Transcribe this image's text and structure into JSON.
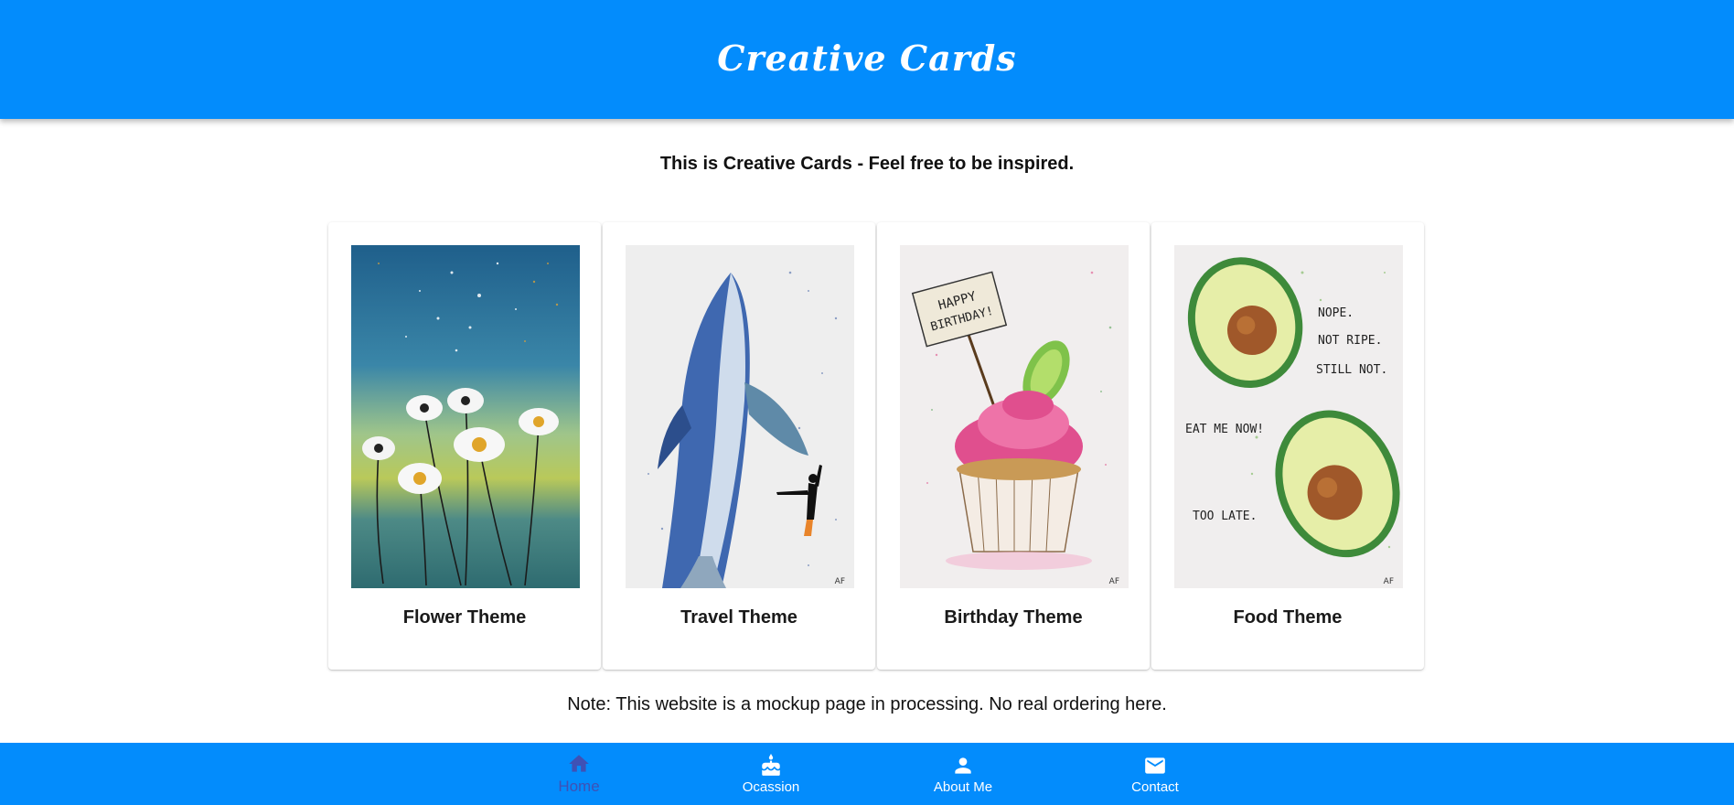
{
  "header": {
    "title": "Creative Cards"
  },
  "intro": {
    "text": "This is Creative Cards - Feel free to be inspired."
  },
  "cards": [
    {
      "title": "Flower Theme",
      "image": "daisy-watercolor"
    },
    {
      "title": "Travel Theme",
      "image": "whale-diver-watercolor",
      "signature": "AF"
    },
    {
      "title": "Birthday Theme",
      "image": "birthday-cupcake-watercolor",
      "sign_line1": "HAPPY",
      "sign_line2": "BIRTHDAY!",
      "signature": "AF"
    },
    {
      "title": "Food Theme",
      "image": "avocado-watercolor",
      "lines": [
        "NOPE.",
        "NOT RIPE.",
        "STILL NOT.",
        "EAT ME NOW!",
        "TOO LATE."
      ],
      "signature": "AF"
    }
  ],
  "note": {
    "text": "Note: This website is a mockup page in processing. No real ordering here."
  },
  "bottom_nav": {
    "active": "home",
    "items": [
      {
        "id": "home",
        "label": "Home",
        "icon": "home-icon"
      },
      {
        "id": "occasion",
        "label": "Ocassion",
        "icon": "cake-icon"
      },
      {
        "id": "about",
        "label": "About Me",
        "icon": "person-icon"
      },
      {
        "id": "contact",
        "label": "Contact",
        "icon": "mail-icon"
      }
    ]
  },
  "colors": {
    "primary": "#038cfc",
    "active_nav": "#3f51b5",
    "text": "#111111"
  }
}
